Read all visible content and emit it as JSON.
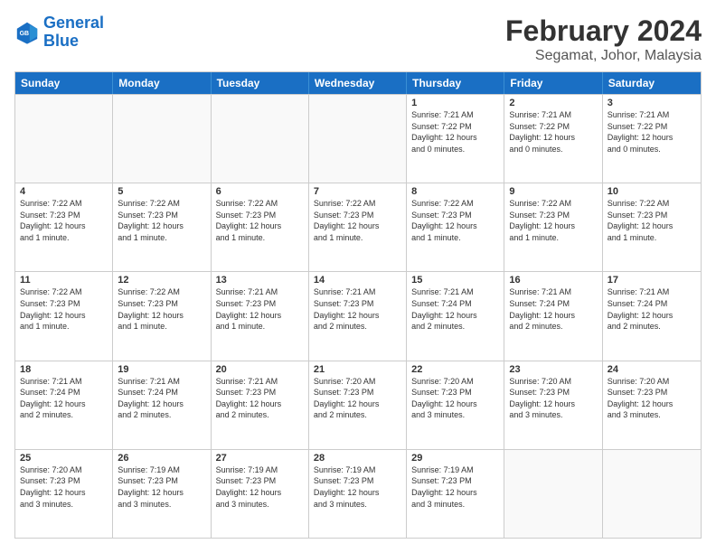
{
  "logo": {
    "line1": "General",
    "line2": "Blue"
  },
  "title": "February 2024",
  "subtitle": "Segamat, Johor, Malaysia",
  "headers": [
    "Sunday",
    "Monday",
    "Tuesday",
    "Wednesday",
    "Thursday",
    "Friday",
    "Saturday"
  ],
  "weeks": [
    [
      {
        "day": "",
        "info": ""
      },
      {
        "day": "",
        "info": ""
      },
      {
        "day": "",
        "info": ""
      },
      {
        "day": "",
        "info": ""
      },
      {
        "day": "1",
        "info": "Sunrise: 7:21 AM\nSunset: 7:22 PM\nDaylight: 12 hours\nand 0 minutes."
      },
      {
        "day": "2",
        "info": "Sunrise: 7:21 AM\nSunset: 7:22 PM\nDaylight: 12 hours\nand 0 minutes."
      },
      {
        "day": "3",
        "info": "Sunrise: 7:21 AM\nSunset: 7:22 PM\nDaylight: 12 hours\nand 0 minutes."
      }
    ],
    [
      {
        "day": "4",
        "info": "Sunrise: 7:22 AM\nSunset: 7:23 PM\nDaylight: 12 hours\nand 1 minute."
      },
      {
        "day": "5",
        "info": "Sunrise: 7:22 AM\nSunset: 7:23 PM\nDaylight: 12 hours\nand 1 minute."
      },
      {
        "day": "6",
        "info": "Sunrise: 7:22 AM\nSunset: 7:23 PM\nDaylight: 12 hours\nand 1 minute."
      },
      {
        "day": "7",
        "info": "Sunrise: 7:22 AM\nSunset: 7:23 PM\nDaylight: 12 hours\nand 1 minute."
      },
      {
        "day": "8",
        "info": "Sunrise: 7:22 AM\nSunset: 7:23 PM\nDaylight: 12 hours\nand 1 minute."
      },
      {
        "day": "9",
        "info": "Sunrise: 7:22 AM\nSunset: 7:23 PM\nDaylight: 12 hours\nand 1 minute."
      },
      {
        "day": "10",
        "info": "Sunrise: 7:22 AM\nSunset: 7:23 PM\nDaylight: 12 hours\nand 1 minute."
      }
    ],
    [
      {
        "day": "11",
        "info": "Sunrise: 7:22 AM\nSunset: 7:23 PM\nDaylight: 12 hours\nand 1 minute."
      },
      {
        "day": "12",
        "info": "Sunrise: 7:22 AM\nSunset: 7:23 PM\nDaylight: 12 hours\nand 1 minute."
      },
      {
        "day": "13",
        "info": "Sunrise: 7:21 AM\nSunset: 7:23 PM\nDaylight: 12 hours\nand 1 minute."
      },
      {
        "day": "14",
        "info": "Sunrise: 7:21 AM\nSunset: 7:23 PM\nDaylight: 12 hours\nand 2 minutes."
      },
      {
        "day": "15",
        "info": "Sunrise: 7:21 AM\nSunset: 7:24 PM\nDaylight: 12 hours\nand 2 minutes."
      },
      {
        "day": "16",
        "info": "Sunrise: 7:21 AM\nSunset: 7:24 PM\nDaylight: 12 hours\nand 2 minutes."
      },
      {
        "day": "17",
        "info": "Sunrise: 7:21 AM\nSunset: 7:24 PM\nDaylight: 12 hours\nand 2 minutes."
      }
    ],
    [
      {
        "day": "18",
        "info": "Sunrise: 7:21 AM\nSunset: 7:24 PM\nDaylight: 12 hours\nand 2 minutes."
      },
      {
        "day": "19",
        "info": "Sunrise: 7:21 AM\nSunset: 7:24 PM\nDaylight: 12 hours\nand 2 minutes."
      },
      {
        "day": "20",
        "info": "Sunrise: 7:21 AM\nSunset: 7:23 PM\nDaylight: 12 hours\nand 2 minutes."
      },
      {
        "day": "21",
        "info": "Sunrise: 7:20 AM\nSunset: 7:23 PM\nDaylight: 12 hours\nand 2 minutes."
      },
      {
        "day": "22",
        "info": "Sunrise: 7:20 AM\nSunset: 7:23 PM\nDaylight: 12 hours\nand 3 minutes."
      },
      {
        "day": "23",
        "info": "Sunrise: 7:20 AM\nSunset: 7:23 PM\nDaylight: 12 hours\nand 3 minutes."
      },
      {
        "day": "24",
        "info": "Sunrise: 7:20 AM\nSunset: 7:23 PM\nDaylight: 12 hours\nand 3 minutes."
      }
    ],
    [
      {
        "day": "25",
        "info": "Sunrise: 7:20 AM\nSunset: 7:23 PM\nDaylight: 12 hours\nand 3 minutes."
      },
      {
        "day": "26",
        "info": "Sunrise: 7:19 AM\nSunset: 7:23 PM\nDaylight: 12 hours\nand 3 minutes."
      },
      {
        "day": "27",
        "info": "Sunrise: 7:19 AM\nSunset: 7:23 PM\nDaylight: 12 hours\nand 3 minutes."
      },
      {
        "day": "28",
        "info": "Sunrise: 7:19 AM\nSunset: 7:23 PM\nDaylight: 12 hours\nand 3 minutes."
      },
      {
        "day": "29",
        "info": "Sunrise: 7:19 AM\nSunset: 7:23 PM\nDaylight: 12 hours\nand 3 minutes."
      },
      {
        "day": "",
        "info": ""
      },
      {
        "day": "",
        "info": ""
      }
    ]
  ]
}
